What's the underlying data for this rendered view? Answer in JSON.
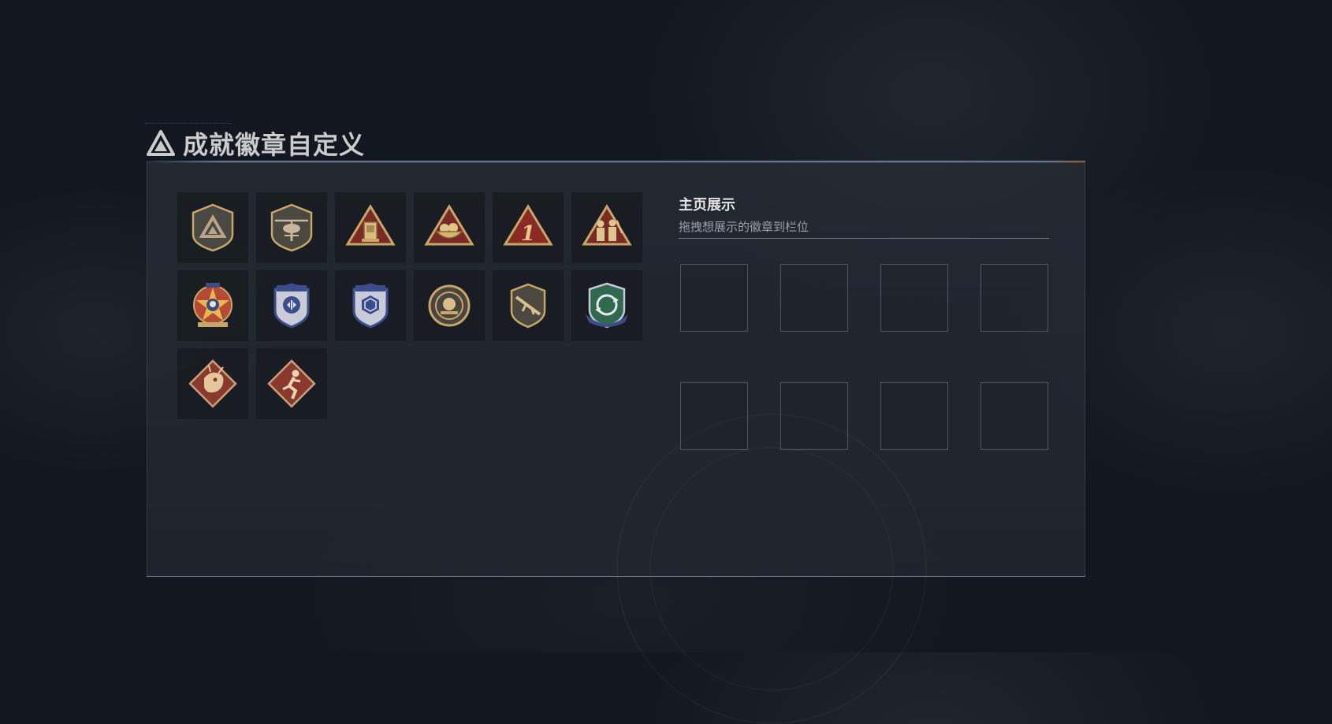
{
  "header": {
    "title": "成就徽章自定义",
    "logo_icon": "delta-logo-icon"
  },
  "badges": [
    {
      "name": "badge-delta-shield",
      "icon": "delta-shield-icon"
    },
    {
      "name": "badge-helicopter",
      "icon": "helicopter-icon"
    },
    {
      "name": "badge-lantern",
      "icon": "lantern-icon"
    },
    {
      "name": "badge-bowl",
      "icon": "bowl-icon"
    },
    {
      "name": "badge-number-one",
      "icon": "number-one-icon"
    },
    {
      "name": "badge-soldiers",
      "icon": "soldiers-icon"
    },
    {
      "name": "badge-star-skull",
      "icon": "star-skull-icon"
    },
    {
      "name": "badge-blue-wings",
      "icon": "blue-wings-icon"
    },
    {
      "name": "badge-blue-gem",
      "icon": "blue-gem-icon"
    },
    {
      "name": "badge-orb",
      "icon": "orb-icon"
    },
    {
      "name": "badge-rifle",
      "icon": "rifle-icon"
    },
    {
      "name": "badge-green-arrows",
      "icon": "green-arrows-icon"
    },
    {
      "name": "badge-dragon",
      "icon": "dragon-icon"
    },
    {
      "name": "badge-runner",
      "icon": "runner-icon"
    }
  ],
  "showcase": {
    "title": "主页展示",
    "subtitle": "拖拽想展示的徽章到栏位",
    "slot_count": 8
  },
  "colors": {
    "gold": "#c8a766",
    "crimson": "#7a2a24",
    "navy": "#3a4c8c",
    "green": "#2f6a4c"
  }
}
